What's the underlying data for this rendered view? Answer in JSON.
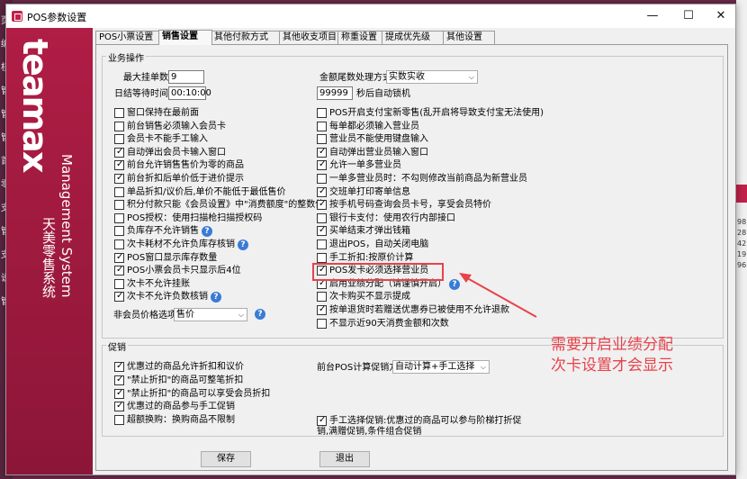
{
  "window": {
    "title": "POS参数设置",
    "minimize": "—",
    "maximize": "☐",
    "close": "✕"
  },
  "brand": {
    "logo": "teamax",
    "subtitle": "Management System",
    "subtitle_cn": "天美零售系统"
  },
  "desktop": {
    "left_chars": [
      "页",
      "编",
      "核",
      "管",
      "管",
      "管",
      "首",
      "零",
      "支",
      "管",
      "支",
      "说",
      "管"
    ],
    "right_chars": [
      "98",
      "28",
      "42",
      "19",
      "96"
    ]
  },
  "tabs": [
    {
      "label": "POS小票设置",
      "active": false
    },
    {
      "label": "销售设置",
      "active": true
    },
    {
      "label": "其他付款方式",
      "active": false
    },
    {
      "label": "其他收支项目",
      "active": false
    },
    {
      "label": "称重设置",
      "active": false
    },
    {
      "label": "提成优先级",
      "active": false
    },
    {
      "label": "其他设置",
      "active": false
    }
  ],
  "business": {
    "legend": "业务操作",
    "max_hold_label": "最大挂单数",
    "max_hold_value": "9",
    "daily_close_label": "日结等待时间",
    "daily_close_value": "00:10:00",
    "rounding_label": "金额尾数处理方式",
    "rounding_value": "实数实收",
    "autolock_value": "99999",
    "autolock_label": "秒后自动锁机",
    "left_options": [
      {
        "label": "窗口保持在最前面",
        "checked": false
      },
      {
        "label": "前台销售必须输入会员卡",
        "checked": false
      },
      {
        "label": "会员卡不能手工输入",
        "checked": false
      },
      {
        "label": "自动弹出会员卡输入窗口",
        "checked": true
      },
      {
        "label": "前台允许销售售价为零的商品",
        "checked": true
      },
      {
        "label": "前台折扣后单价低于进价提示",
        "checked": true
      },
      {
        "label": "单品折扣/议价后,单价不能低于最低售价",
        "checked": false
      },
      {
        "label": "积分付款只能《会员设置》中\"消费额度\"的整数倍",
        "checked": false
      },
      {
        "label": "POS授权：使用扫描枪扫描授权码",
        "checked": false
      },
      {
        "label": "负库存不允许销售",
        "checked": false,
        "help": true
      },
      {
        "label": "次卡耗材不允许负库存核销",
        "checked": false,
        "help": true
      },
      {
        "label": "POS窗口显示库存数量",
        "checked": true
      },
      {
        "label": "POS小票会员卡只显示后4位",
        "checked": true
      },
      {
        "label": "次卡不允许挂账",
        "checked": false
      },
      {
        "label": "次卡不允许负数核销",
        "checked": true,
        "help": true
      }
    ],
    "nonmember_price_label": "非会员价格选项",
    "nonmember_price_value": "售价",
    "right_options": [
      {
        "label": "POS开启支付宝新零售(乱开启将导致支付宝无法使用)",
        "checked": false
      },
      {
        "label": "每单都必须输入营业员",
        "checked": false
      },
      {
        "label": "营业员不能使用键盘输入",
        "checked": false
      },
      {
        "label": "自动弹出营业员输入窗口",
        "checked": true
      },
      {
        "label": "允许一单多营业员",
        "checked": true
      },
      {
        "label": "一单多营业员时：不勾则修改当前商品为新营业员",
        "checked": false
      },
      {
        "label": "交班单打印寄单信息",
        "checked": true
      },
      {
        "label": "按手机号码查询会员卡号，享受会员特价",
        "checked": true
      },
      {
        "label": "银行卡支付：使用农行内部接口",
        "checked": false
      },
      {
        "label": "买单结束才弹出钱箱",
        "checked": true
      },
      {
        "label": "退出POS，自动关闭电脑",
        "checked": false
      },
      {
        "label": "手工折扣:按原价计算",
        "checked": false
      },
      {
        "label": "POS发卡必须选择营业员",
        "checked": true
      },
      {
        "label": "启用业绩分配（请谨慎开启）",
        "checked": true,
        "help": true
      },
      {
        "label": "次卡购买不显示提成",
        "checked": false
      },
      {
        "label": "按单退货时若赠送优惠券已被使用不允许退款",
        "checked": true
      },
      {
        "label": "不显示近90天消费金额和次数",
        "checked": false
      }
    ]
  },
  "promo": {
    "legend": "促销",
    "mode_label": "前台POS计算促销方式",
    "mode_value": "自动计算+手工选择",
    "left_options": [
      {
        "label": "优惠过的商品允许折扣和议价",
        "checked": true
      },
      {
        "label": "\"禁止折扣\"的商品可整笔折扣",
        "checked": true
      },
      {
        "label": "\"禁止折扣\"的商品可以享受会员折扣",
        "checked": true
      },
      {
        "label": "优惠过的商品参与手工促销",
        "checked": true
      },
      {
        "label": "超额换购：换购商品不限制",
        "checked": false
      }
    ],
    "right_option": {
      "label": "手工选择促销:优惠过的商品可以参与阶梯打折促销,满赠促销,条件组合促销",
      "checked": true
    }
  },
  "buttons": {
    "save": "保存",
    "exit": "退出"
  },
  "annotation": {
    "line1": "需要开启业绩分配",
    "line2": "次卡设置才会显示",
    "color": "#e8424a"
  }
}
